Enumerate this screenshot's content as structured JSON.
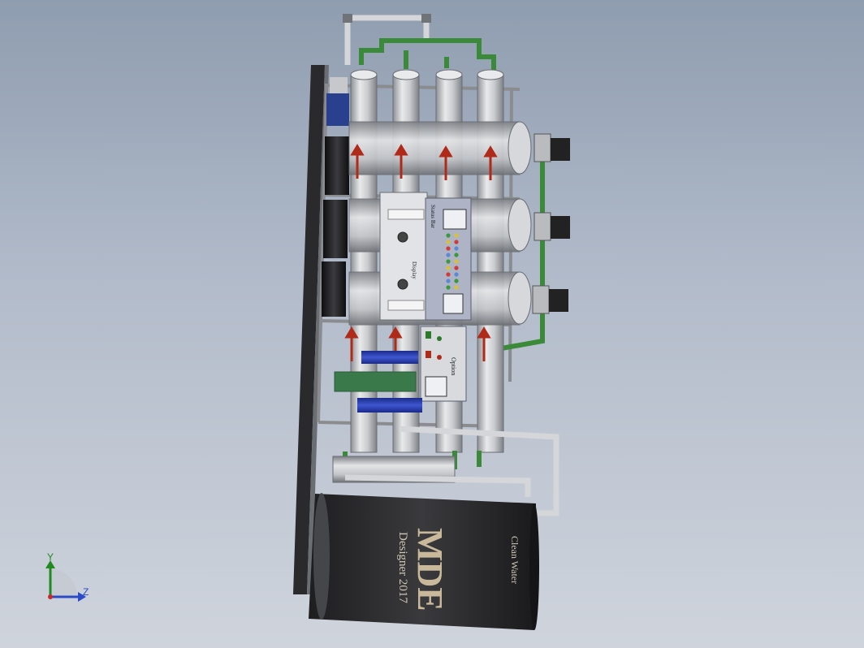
{
  "viewport": {
    "background_top": "#8f9db0",
    "background_bottom": "#cfd4dc"
  },
  "tank": {
    "brand": "MDE",
    "designer": "Designer 2017",
    "product": "Clean Water",
    "color": "#2f2f31"
  },
  "control_panel": {
    "title": "Display",
    "subtitle": "Status Bar",
    "status_label": "Status",
    "indicator_colors": [
      "#3a9a3a",
      "#d6c23a",
      "#d23a3a",
      "#5a8ad6"
    ]
  },
  "lower_panel": {
    "label": "Option"
  },
  "pipes": {
    "green": "#3a8a3a",
    "gray": "#d4d6d9"
  },
  "triad": {
    "y_label": "Y",
    "z_label": "Z",
    "y_color": "#1f8a1f",
    "z_color": "#2a4ac8",
    "x_color": "#c82a2a"
  }
}
